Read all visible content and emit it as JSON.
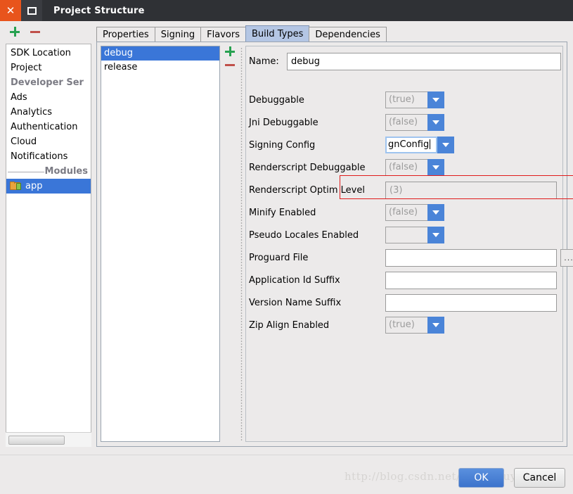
{
  "window": {
    "title": "Project Structure",
    "close_icon": "close-icon",
    "maximize_icon": "maximize-icon"
  },
  "left_toolbar": {
    "add_label": "+",
    "remove_label": "−"
  },
  "sidebar": {
    "items": [
      {
        "label": "SDK Location",
        "type": "item",
        "selected": false
      },
      {
        "label": "Project",
        "type": "item",
        "selected": false
      },
      {
        "label": "Developer Ser",
        "type": "header",
        "selected": false
      },
      {
        "label": "Ads",
        "type": "item",
        "selected": false
      },
      {
        "label": "Analytics",
        "type": "item",
        "selected": false
      },
      {
        "label": "Authentication",
        "type": "item",
        "selected": false
      },
      {
        "label": "Cloud",
        "type": "item",
        "selected": false
      },
      {
        "label": "Notifications",
        "type": "item",
        "selected": false
      },
      {
        "label": "Modules",
        "type": "header",
        "selected": false
      },
      {
        "label": "app",
        "type": "module",
        "selected": true
      }
    ]
  },
  "tabs": [
    {
      "label": "Properties",
      "active": false
    },
    {
      "label": "Signing",
      "active": false
    },
    {
      "label": "Flavors",
      "active": false
    },
    {
      "label": "Build Types",
      "active": true
    },
    {
      "label": "Dependencies",
      "active": false
    }
  ],
  "build_types": {
    "items": [
      {
        "label": "debug",
        "selected": true
      },
      {
        "label": "release",
        "selected": false
      }
    ],
    "add_label": "+",
    "remove_label": "−"
  },
  "form": {
    "name_label": "Name:",
    "name_value": "debug",
    "rows": [
      {
        "label": "Debuggable",
        "kind": "combo",
        "value": "(true)"
      },
      {
        "label": "Jni Debuggable",
        "kind": "combo",
        "value": "(false)"
      },
      {
        "label": "Signing Config",
        "kind": "combo-edit",
        "value": "gnConfig"
      },
      {
        "label": "Renderscript Debuggable",
        "kind": "combo",
        "value": "(false)"
      },
      {
        "label": "Renderscript Optim Level",
        "kind": "text-muted",
        "value": "(3)"
      },
      {
        "label": "Minify Enabled",
        "kind": "combo",
        "value": "(false)"
      },
      {
        "label": "Pseudo Locales Enabled",
        "kind": "combo",
        "value": ""
      },
      {
        "label": "Proguard File",
        "kind": "text-browse",
        "value": "",
        "browse_label": "..."
      },
      {
        "label": "Application Id Suffix",
        "kind": "text",
        "value": ""
      },
      {
        "label": "Version Name Suffix",
        "kind": "text",
        "value": ""
      },
      {
        "label": "Zip Align Enabled",
        "kind": "combo",
        "value": "(true)"
      }
    ]
  },
  "footer": {
    "watermark": "http://blog.csdn.net/jackzhouyu",
    "ok_label": "OK",
    "cancel_label": "Cancel"
  },
  "colors": {
    "accent_blue": "#3a76d8",
    "combo_button_blue": "#4a84d8",
    "tab_active": "#b4c6e4",
    "highlight_red": "#e01b1b",
    "titlebar": "#2f3135",
    "close_orange": "#e8541c"
  }
}
